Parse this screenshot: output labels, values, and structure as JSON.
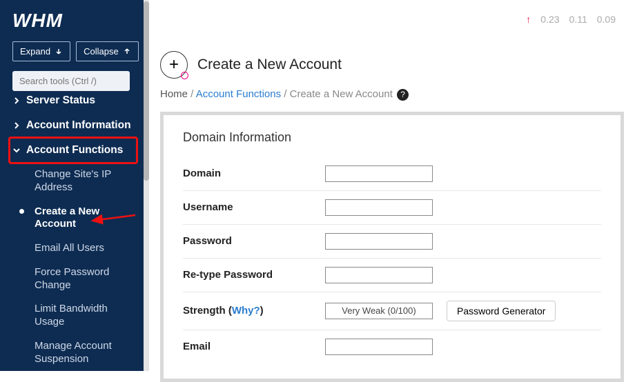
{
  "logo": "WHM",
  "buttons": {
    "expand": "Expand",
    "collapse": "Collapse"
  },
  "search_placeholder": "Search tools (Ctrl /)",
  "nav": {
    "server_status": "Server Status",
    "account_info": "Account Information",
    "account_functions": "Account Functions",
    "sub": {
      "change_ip": "Change Site's IP Address",
      "create_acc": "Create a New Account",
      "email_all": "Email All Users",
      "force_pw": "Force Password Change",
      "limit_bw": "Limit Bandwidth Usage",
      "manage_susp": "Manage Account Suspension"
    }
  },
  "load": {
    "l1": "0.23",
    "l2": "0.11",
    "l3": "0.09"
  },
  "page": {
    "title": "Create a New Account"
  },
  "crumbs": {
    "home": "Home",
    "af": "Account Functions",
    "cur": "Create a New Account"
  },
  "panel": {
    "heading": "Domain Information",
    "domain": "Domain",
    "username": "Username",
    "password": "Password",
    "retype": "Re-type Password",
    "strength": "Strength (",
    "why": "Why?",
    "strength_close": ")",
    "strength_val": "Very Weak (0/100)",
    "pwgen": "Password Generator",
    "email": "Email"
  }
}
